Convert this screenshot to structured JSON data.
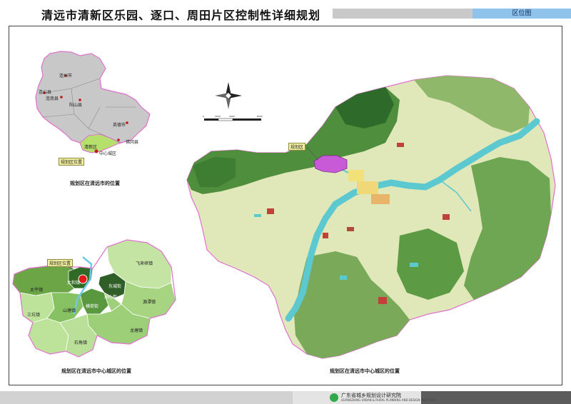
{
  "title": "清远市清新区乐园、逐口、周田片区控制性详细规划",
  "header_tag": "区位图",
  "map1": {
    "caption": "规划区在清远市的位置",
    "callout": "规划区位置",
    "labels": {
      "l1": "连州市",
      "l2": "连山县",
      "l3": "连南县",
      "l4": "阳山县",
      "l5": "英德市",
      "l6": "佛冈县",
      "l7": "清新区",
      "l8": "中心城区"
    },
    "colors": {
      "region": "#c8c8c8",
      "plan": "#b5e06c",
      "border": "#e070d0"
    }
  },
  "map2": {
    "caption": "规划区在清远市中心城区的位置",
    "callout": "规划区位置",
    "labels": {
      "l1": "太平镇",
      "l2": "太和镇",
      "l3": "三坑镇",
      "l4": "山塘镇",
      "l5": "横荷街",
      "l6": "洲心街",
      "l7": "东城街",
      "l8": "飞来峡镇",
      "l9": "源潭镇",
      "l10": "龙塘镇",
      "l11": "石角镇"
    }
  },
  "map3": {
    "caption": "规划区在清远市中心城区的位置",
    "callout": "规划区",
    "scale_labels": [
      "0",
      "2000",
      "4000",
      "8000"
    ]
  },
  "footer": {
    "org": "广东省城乡规划设计研究院",
    "org_en": "GUANGDONG URBAN & RURAL PLANNING AND DESIGN INSTITUTE"
  }
}
